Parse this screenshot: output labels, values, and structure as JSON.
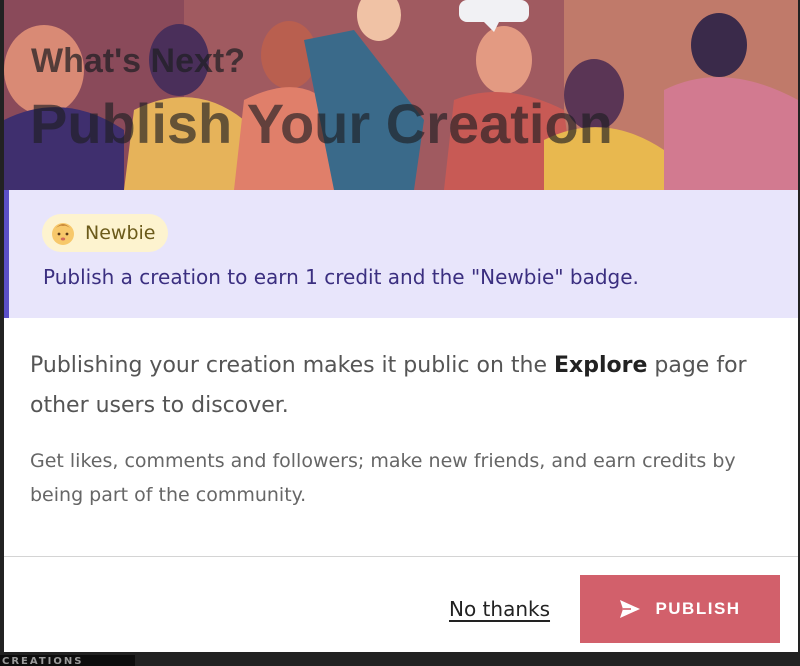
{
  "hero": {
    "overline": "What's Next?",
    "title": "Publish Your Creation"
  },
  "reward": {
    "badge_icon": "baby-face-icon",
    "badge_label": "Newbie",
    "text": "Publish a creation to earn 1 credit and the \"Newbie\" badge."
  },
  "body": {
    "p1_before": "Publishing your creation makes it public on the ",
    "p1_bold": "Explore",
    "p1_after": " page for other users to discover.",
    "p2": "Get likes, comments and followers; make new friends, and earn credits by being part of the community."
  },
  "footer": {
    "no_thanks_label": "No thanks",
    "publish_label": "PUBLISH",
    "publish_icon": "send-icon"
  },
  "background": {
    "strip_text": "CREATIONS"
  },
  "colors": {
    "reward_bg": "#e8e5fb",
    "reward_accent": "#5a4fc8",
    "reward_text": "#3b2f80",
    "badge_bg": "#fdf3cf",
    "publish_button": "#d2606b"
  }
}
